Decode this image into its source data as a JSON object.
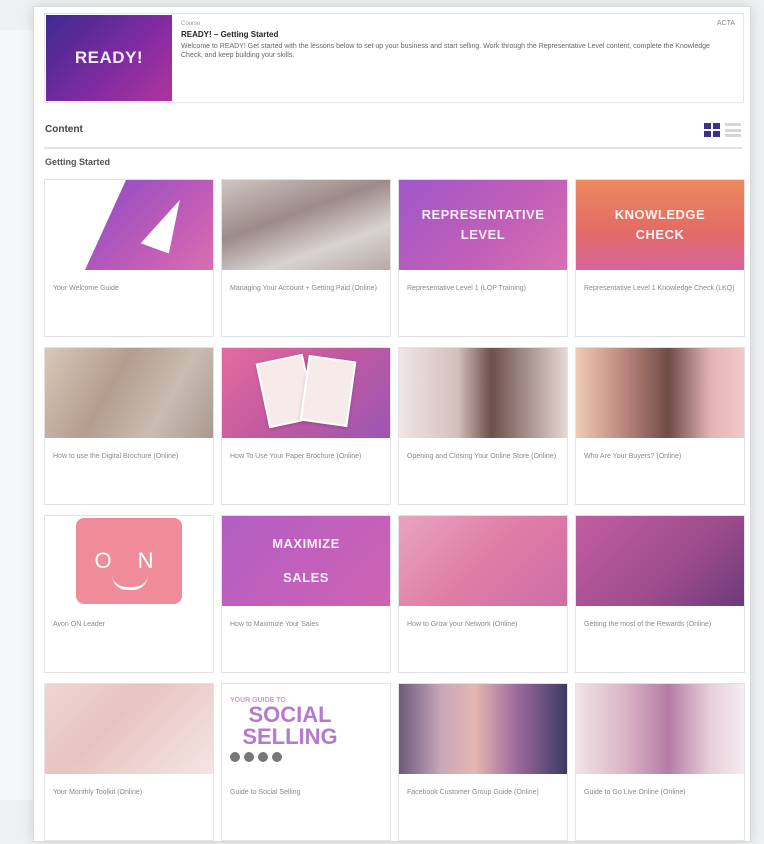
{
  "course": {
    "thumb_text": "READY!",
    "eyebrow": "Course",
    "title": "READY! – Getting Started",
    "description": "Welcome to READY! Get started with the lessons below to set up your business and start selling. Work through the Representative Level content, complete the Knowledge Check, and keep building your skills.",
    "code": "ACTA"
  },
  "content_bar": {
    "label": "Content",
    "grid_view_icon": "grid-view-icon",
    "list_view_icon": "list-view-icon"
  },
  "section": {
    "title": "Getting Started"
  },
  "lessons": [
    {
      "title": "Your Welcome Guide",
      "thumb": "triangle"
    },
    {
      "title": "Managing Your Account + Getting Paid (Online)",
      "thumb": "photo-a"
    },
    {
      "title": "Representative Level 1 (LOP Training)",
      "thumb": "rep",
      "thumb_text": "REPRESENTATIVE LEVEL"
    },
    {
      "title": "Representative Level 1 Knowledge Check (LKQ)",
      "thumb": "know",
      "thumb_text": "KNOWLEDGE CHECK"
    },
    {
      "title": "How to use the Digital Brochure (Online)",
      "thumb": "photo-b"
    },
    {
      "title": "How To Use Your Paper Brochure (Online)",
      "thumb": "brochure"
    },
    {
      "title": "Opening and Closing Your Online Store (Online)",
      "thumb": "photo-c"
    },
    {
      "title": "Who Are Your Buyers? (Online)",
      "thumb": "photo-d"
    },
    {
      "title": "Avon ON Leader",
      "thumb": "on",
      "thumb_text": "O N"
    },
    {
      "title": "How to Maximize Your Sales",
      "thumb": "max",
      "thumb_text": "MAXIMIZE SALES"
    },
    {
      "title": "How to Grow your Network (Online)",
      "thumb": "soft"
    },
    {
      "title": "Getting the most of the Rewards (Online)",
      "thumb": "dark"
    },
    {
      "title": "Your Monthly Toolkit (Online)",
      "thumb": "photo-e"
    },
    {
      "title": "Guide to Social Selling",
      "thumb": "social",
      "thumb_small": "YOUR GUIDE TO",
      "thumb_text": "SOCIAL SELLING"
    },
    {
      "title": "Facebook Customer Group Guide (Online)",
      "thumb": "photo-f"
    },
    {
      "title": "Guide to Go Live Online (Online)",
      "thumb": "photo-g"
    }
  ],
  "colors": {
    "brand_purple": "#3c2f8d",
    "accent_magenta": "#c35fb7"
  }
}
